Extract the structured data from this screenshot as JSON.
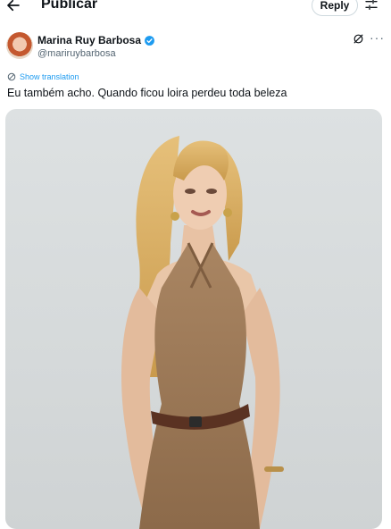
{
  "header": {
    "title": "Publicar",
    "reply_label": "Reply",
    "back_icon": "arrow-left-icon",
    "settings_icon": "sliders-icon"
  },
  "tweet": {
    "author_name": "Marina Ruy Barbosa",
    "handle": "@mariruybarbosa",
    "verified": true,
    "show_translation": "Show translation",
    "text": "Eu também acho. Quando ficou loira perdeu toda beleza"
  },
  "colors": {
    "accent": "#1d9bf0",
    "text": "#0f1419",
    "muted": "#536471"
  }
}
